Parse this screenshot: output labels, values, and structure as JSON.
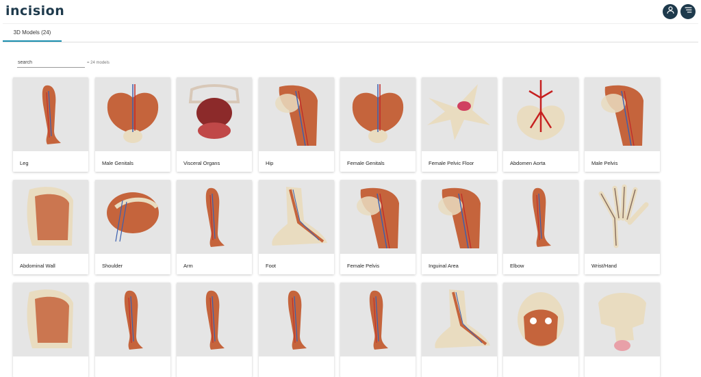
{
  "app": {
    "logo": "incision"
  },
  "header": {
    "user_icon": "user-icon",
    "menu_icon": "menu-icon"
  },
  "tabs": [
    {
      "label": "3D Models (24)",
      "active": true
    }
  ],
  "search": {
    "placeholder": "search",
    "value": "",
    "count_text": "= 24 models"
  },
  "models": [
    {
      "label": "Leg",
      "shape": "limb"
    },
    {
      "label": "Male Genitals",
      "shape": "pelvis"
    },
    {
      "label": "Visceral Organs",
      "shape": "organs"
    },
    {
      "label": "Hip",
      "shape": "hip"
    },
    {
      "label": "Female Genitals",
      "shape": "pelvis"
    },
    {
      "label": "Female Pelvic Floor",
      "shape": "bone"
    },
    {
      "label": "Abdomen Aorta",
      "shape": "aorta"
    },
    {
      "label": "Male Pelvis",
      "shape": "hip"
    },
    {
      "label": "Abdominal Wall",
      "shape": "torso"
    },
    {
      "label": "Shoulder",
      "shape": "shoulder"
    },
    {
      "label": "Arm",
      "shape": "limb"
    },
    {
      "label": "Foot",
      "shape": "foot"
    },
    {
      "label": "Female Pelvis",
      "shape": "hip"
    },
    {
      "label": "Inguinal Area",
      "shape": "hip"
    },
    {
      "label": "Elbow",
      "shape": "limb"
    },
    {
      "label": "Wrist/Hand",
      "shape": "hand"
    },
    {
      "label": "",
      "shape": "torso"
    },
    {
      "label": "",
      "shape": "limb"
    },
    {
      "label": "",
      "shape": "limb"
    },
    {
      "label": "",
      "shape": "limb"
    },
    {
      "label": "",
      "shape": "limb"
    },
    {
      "label": "",
      "shape": "foot"
    },
    {
      "label": "",
      "shape": "head"
    },
    {
      "label": "",
      "shape": "skull"
    }
  ],
  "colors": {
    "brand": "#1e3a4c",
    "accent": "#1a8fb0",
    "muscle": "#c5643c",
    "bone": "#e9dcc0",
    "thumb_bg": "#e5e5e5"
  }
}
